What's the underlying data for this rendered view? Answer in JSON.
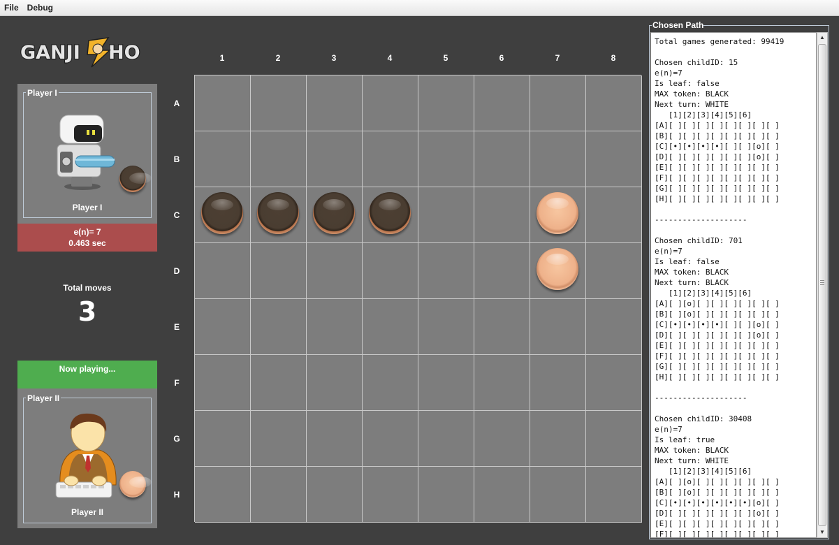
{
  "menu": {
    "file": "File",
    "debug": "Debug"
  },
  "logo": {
    "text": "GANJI HO"
  },
  "player1": {
    "group_title": "Player I",
    "name": "Player I",
    "token": "black",
    "avatar_icon": "robot-icon",
    "stats_line1": "e(n)= 7",
    "stats_line2": "0.463 sec"
  },
  "total_moves": {
    "label": "Total moves",
    "value": "3"
  },
  "now_playing": {
    "label": "Now playing..."
  },
  "player2": {
    "group_title": "Player II",
    "name": "Player II",
    "token": "white",
    "avatar_icon": "human-player-icon"
  },
  "board": {
    "columns": [
      "1",
      "2",
      "3",
      "4",
      "5",
      "6",
      "7",
      "8"
    ],
    "rows": [
      "A",
      "B",
      "C",
      "D",
      "E",
      "F",
      "G",
      "H"
    ],
    "pieces": [
      {
        "row": "C",
        "col": 1,
        "color": "black"
      },
      {
        "row": "C",
        "col": 2,
        "color": "black"
      },
      {
        "row": "C",
        "col": 3,
        "color": "black"
      },
      {
        "row": "C",
        "col": 4,
        "color": "black"
      },
      {
        "row": "C",
        "col": 7,
        "color": "white"
      },
      {
        "row": "D",
        "col": 7,
        "color": "white"
      }
    ]
  },
  "chosen_path": {
    "title": "Chosen Path",
    "text": "Total games generated: 99419\n\nChosen childID: 15\ne(n)=7\nIs leaf: false\nMAX token: BLACK\nNext turn: WHITE\n   [1][2][3][4][5][6]\n[A][ ][ ][ ][ ][ ][ ][ ][ ]\n[B][ ][ ][ ][ ][ ][ ][ ][ ]\n[C][•][•][•][•][ ][ ][o][ ]\n[D][ ][ ][ ][ ][ ][ ][o][ ]\n[E][ ][ ][ ][ ][ ][ ][ ][ ]\n[F][ ][ ][ ][ ][ ][ ][ ][ ]\n[G][ ][ ][ ][ ][ ][ ][ ][ ]\n[H][ ][ ][ ][ ][ ][ ][ ][ ]\n\n--------------------\n\nChosen childID: 701\ne(n)=7\nIs leaf: false\nMAX token: BLACK\nNext turn: BLACK\n   [1][2][3][4][5][6]\n[A][ ][o][ ][ ][ ][ ][ ][ ]\n[B][ ][o][ ][ ][ ][ ][ ][ ]\n[C][•][•][•][•][ ][ ][o][ ]\n[D][ ][ ][ ][ ][ ][ ][o][ ]\n[E][ ][ ][ ][ ][ ][ ][ ][ ]\n[F][ ][ ][ ][ ][ ][ ][ ][ ]\n[G][ ][ ][ ][ ][ ][ ][ ][ ]\n[H][ ][ ][ ][ ][ ][ ][ ][ ]\n\n--------------------\n\nChosen childID: 30408\ne(n)=7\nIs leaf: true\nMAX token: BLACK\nNext turn: WHITE\n   [1][2][3][4][5][6]\n[A][ ][o][ ][ ][ ][ ][ ][ ]\n[B][ ][o][ ][ ][ ][ ][ ][ ]\n[C][•][•][•][•][•][•][o][ ]\n[D][ ][ ][ ][ ][ ][ ][o][ ]\n[E][ ][ ][ ][ ][ ][ ][ ][ ]\n[F][ ][ ][ ][ ][ ][ ][ ][ ]"
  }
}
